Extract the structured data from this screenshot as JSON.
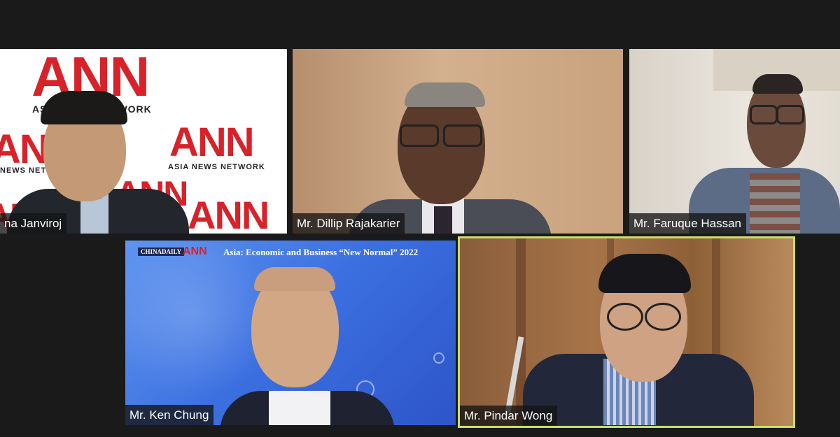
{
  "participants": [
    {
      "name": "na Janviroj",
      "active": false
    },
    {
      "name": "Mr. Dillip Rajakarier",
      "active": false
    },
    {
      "name": "Mr. Faruque Hassan",
      "active": false
    },
    {
      "name": "Mr. Ken Chung",
      "active": false
    },
    {
      "name": "Mr. Pindar Wong",
      "active": true
    }
  ],
  "backdrop": {
    "ann_logo": "ANN",
    "ann_network_line": "ASIA NEWS NETWORK",
    "ann_network_partial_left": "AS",
    "ann_network_partial_right": "NETWORK",
    "ann_network_partial_edge": "NEWS NET"
  },
  "banner": {
    "china_daily": "CHINADAILY",
    "ann_logo": "ANN",
    "title": "Asia: Economic and Business “New Normal” 2022"
  },
  "colors": {
    "background": "#1a1a1a",
    "active_speaker_border": "#c8e06a",
    "ann_red": "#d8222a",
    "banner_blue": "#3b6fe0"
  }
}
